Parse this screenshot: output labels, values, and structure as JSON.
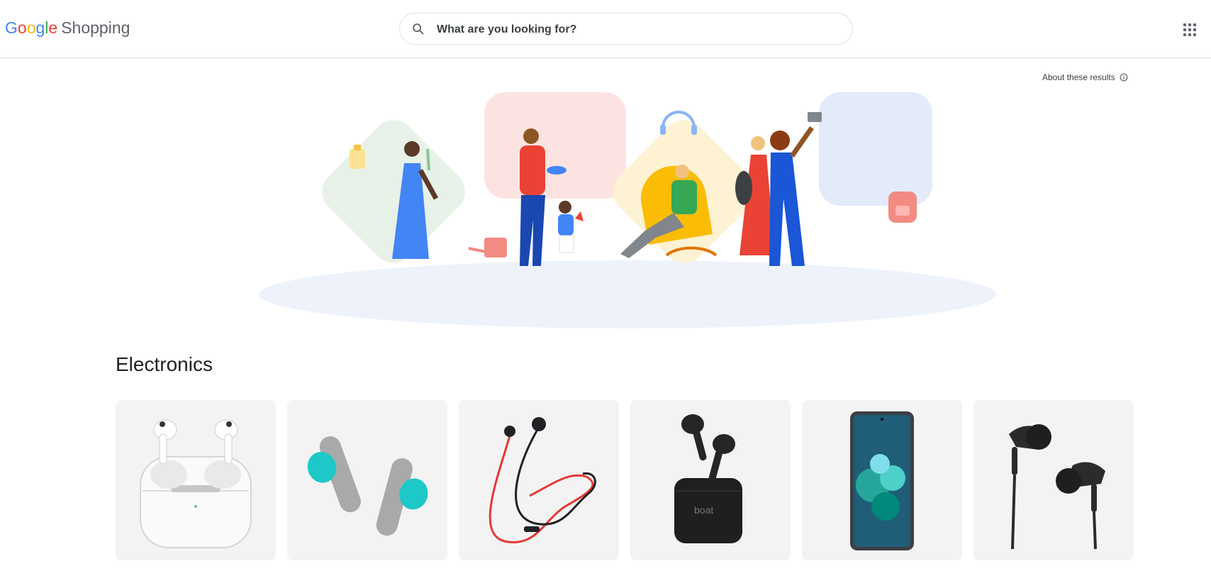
{
  "header": {
    "logo": {
      "letters": [
        "G",
        "o",
        "o",
        "g",
        "l",
        "e"
      ],
      "product": "Shopping"
    },
    "search": {
      "placeholder": "What are you looking for?",
      "value": ""
    }
  },
  "about": {
    "label": "About these results"
  },
  "section": {
    "title": "Electronics"
  },
  "products": [
    {
      "name": "white-earbuds-case"
    },
    {
      "name": "gray-teal-earbuds"
    },
    {
      "name": "red-black-neckband"
    },
    {
      "name": "boat-black-earbuds"
    },
    {
      "name": "smartphone"
    },
    {
      "name": "black-wired-earphones"
    }
  ],
  "colors": {
    "blue": "#4285f4",
    "red": "#ea4335",
    "yellow": "#fbbc05",
    "green": "#34a853",
    "card_bg": "#f3f3f3"
  }
}
